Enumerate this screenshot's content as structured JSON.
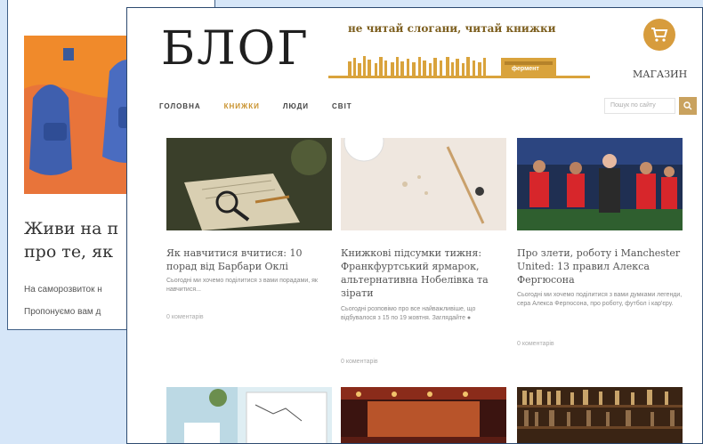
{
  "back_page": {
    "title_line1": "Живи на п",
    "title_line2": "про те, як",
    "text_line1": "На саморозвиток н",
    "text_line2": "Пропонуємо вам д"
  },
  "header": {
    "brand": "БЛОГ",
    "slogan": "не читай слогани, читай книжки",
    "store_logo": "фермент",
    "shop_label": "МАГАЗИН",
    "cart_icon": "cart-icon"
  },
  "nav": {
    "items": [
      {
        "label": "ГОЛОВНА",
        "active": false
      },
      {
        "label": "КНИЖКИ",
        "active": true
      },
      {
        "label": "ЛЮДИ",
        "active": false
      },
      {
        "label": "СВІТ",
        "active": false
      }
    ],
    "search_placeholder": "Пошук по сайту"
  },
  "cards": [
    {
      "title": "Як навчитися вчитися: 10 порад від Барбари Оклі",
      "excerpt": "Сьогодні ми хочемо поділитися з вами порадами, як навчитися...",
      "meta": "0 коментарів"
    },
    {
      "title": "Книжкові підсумки тижня: Франкфуртський ярмарок, альтернативна Нобелівка та зірати",
      "excerpt": "Сьогодні розповімо про все найважливіше, що відбувалося з 15 по 19 жовтня. Заглядайте ●",
      "meta": "0 коментарів"
    },
    {
      "title": "Про злети, роботу і Manchester United: 13 правил Алекса Фергюсона",
      "excerpt": "Сьогодні ми хочемо поділитися з вами думками легенди, сера Алекса Фергюсона, про роботу, футбол і кар'єру.",
      "meta": "0 коментарів"
    }
  ],
  "colors": {
    "accent": "#c9922d",
    "cart": "#d79c3d",
    "back_orange": "#f08a2b",
    "desktop": "#d6e6f8"
  }
}
